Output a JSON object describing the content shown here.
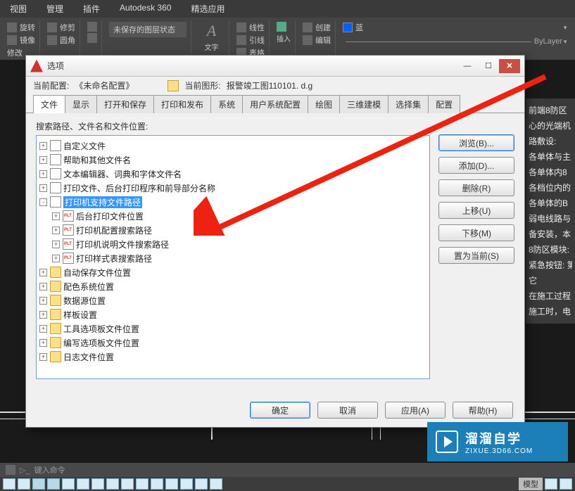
{
  "ribbon": {
    "tabs": [
      "视图",
      "管理",
      "插件",
      "Autodesk 360",
      "精选应用"
    ],
    "rot": "旋转",
    "trim": "修剪",
    "mirror": "镜像",
    "fillet": "圆角",
    "line": "线性",
    "lead": "引线",
    "table": "表格",
    "text_panel": "文字",
    "create": "创建",
    "edit": "编辑",
    "insert": "插入",
    "unsaved": "未保存的图层状态",
    "layer_color": "蓝",
    "bylayer": "ByLayer",
    "modify": "修改"
  },
  "dialog": {
    "title": "选项",
    "cfg_label": "当前配置:",
    "cfg_value": "《未命名配置》",
    "draw_label": "当前图形:",
    "draw_value": "报警竣工图110101. d.g",
    "tabs": [
      "文件",
      "显示",
      "打开和保存",
      "打印和发布",
      "系统",
      "用户系统配置",
      "绘图",
      "三维建模",
      "选择集",
      "配置"
    ],
    "tree_caption": "搜索路径、文件名和文件位置:",
    "tree": [
      {
        "exp": "+",
        "ico": "doc",
        "label": "自定义文件",
        "lvl": 0
      },
      {
        "exp": "+",
        "ico": "doc",
        "label": "帮助和其他文件名",
        "lvl": 0
      },
      {
        "exp": "+",
        "ico": "doc",
        "label": "文本编辑器、词典和字体文件名",
        "lvl": 0
      },
      {
        "exp": "+",
        "ico": "doc",
        "label": "打印文件、后台打印程序和前导部分名称",
        "lvl": 0
      },
      {
        "exp": "-",
        "ico": "doc",
        "label": "打印机支持文件路径",
        "lvl": 0,
        "sel": true
      },
      {
        "exp": "+",
        "ico": "plt",
        "label": "后台打印文件位置",
        "lvl": 1
      },
      {
        "exp": "+",
        "ico": "plt",
        "label": "打印机配置搜索路径",
        "lvl": 1
      },
      {
        "exp": "+",
        "ico": "plt",
        "label": "打印机说明文件搜索路径",
        "lvl": 1
      },
      {
        "exp": "+",
        "ico": "plt",
        "label": "打印样式表搜索路径",
        "lvl": 1
      },
      {
        "exp": "+",
        "ico": "folder",
        "label": "自动保存文件位置",
        "lvl": 0
      },
      {
        "exp": "+",
        "ico": "folder",
        "label": "配色系统位置",
        "lvl": 0
      },
      {
        "exp": "+",
        "ico": "folder",
        "label": "数据源位置",
        "lvl": 0
      },
      {
        "exp": "+",
        "ico": "folder",
        "label": "样板设置",
        "lvl": 0
      },
      {
        "exp": "+",
        "ico": "folder",
        "label": "工具选项板文件位置",
        "lvl": 0
      },
      {
        "exp": "+",
        "ico": "folder",
        "label": "编写选项板文件位置",
        "lvl": 0
      },
      {
        "exp": "+",
        "ico": "folder",
        "label": "日志文件位置",
        "lvl": 0
      }
    ],
    "buttons": {
      "browse": "浏览(B)...",
      "add": "添加(D)...",
      "remove": "删除(R)",
      "up": "上移(U)",
      "down": "下移(M)",
      "current": "置为当前(S)"
    },
    "ok": "确定",
    "cancel": "取消",
    "apply": "应用(A)",
    "help": "帮助(H)"
  },
  "right": [
    "前端8防区",
    "心的光端机",
    "路敷设:",
    "各单体与主",
    "各单体内8",
    "各档位内的",
    "各单体的B",
    "弱电线路与",
    "备安装，本",
    "8防区模块:",
    "紧急按钮: 第",
    "它",
    "在施工过程",
    "施工时，电"
  ],
  "watermark": {
    "main": "溜溜自学",
    "sub": "ZIXUE.3D66.COM"
  },
  "cmdline": {
    "prompt": "键入命令"
  },
  "statusbar": {
    "model": "模型"
  }
}
